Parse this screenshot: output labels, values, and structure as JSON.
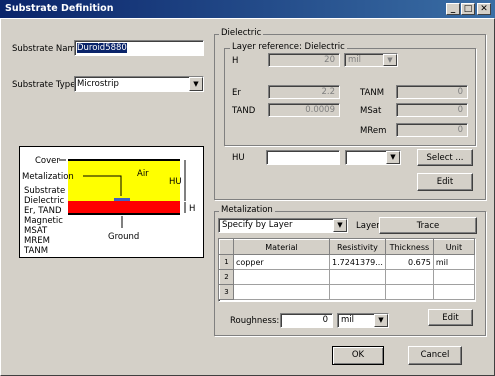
{
  "title": "Substrate Definition",
  "titlebar_buttons": {
    "minimize": "_",
    "maximize": "□",
    "close": "✕"
  },
  "substrate_name": {
    "label": "Substrate Name:",
    "value": "Duroid5880"
  },
  "substrate_type": {
    "label": "Substrate Type:",
    "value": "Microstrip"
  },
  "diagram": {
    "cover": "Cover",
    "metalization": "Metalization",
    "air": "Air",
    "hu": "HU",
    "h": "H",
    "ground": "Ground",
    "substrate_lines": [
      "Substrate",
      "Dielectric",
      "Er, TAND",
      "Magnetic",
      "MSAT",
      "MREM",
      "TANM"
    ]
  },
  "dielectric": {
    "group_label": "Dielectric",
    "layer_label": "Layer reference: Dielectric",
    "h_label": "H",
    "h_value": "20",
    "h_unit": "mil",
    "er_label": "Er",
    "er_value": "2.2",
    "tand_label": "TAND",
    "tand_value": "0.0009",
    "tanm_label": "TANM",
    "tanm_value": "0",
    "msat_label": "MSat",
    "msat_value": "0",
    "mrem_label": "MRem",
    "mrem_value": "0",
    "hu_label": "HU",
    "hu_value": "",
    "hu_unit": "",
    "select_button": "Select ...",
    "edit_button": "Edit"
  },
  "metalization": {
    "group_label": "Metalization",
    "mode": "Specify by Layer",
    "layer_label": "Layer:",
    "layer_button": "Trace",
    "columns": [
      "Material",
      "Resistivity",
      "Thickness",
      "Unit"
    ],
    "rows": [
      {
        "num": "1",
        "material": "copper",
        "resistivity": "1.7241379...",
        "thickness": "0.675",
        "unit": "mil"
      },
      {
        "num": "2",
        "material": "",
        "resistivity": "",
        "thickness": "",
        "unit": ""
      },
      {
        "num": "3",
        "material": "",
        "resistivity": "",
        "thickness": "",
        "unit": ""
      }
    ],
    "roughness_label": "Roughness:",
    "roughness_value": "0",
    "roughness_unit": "mil",
    "edit_button": "Edit"
  },
  "ok_button": "OK",
  "cancel_button": "Cancel",
  "colors": {
    "air": "#ffff00",
    "substrate": "#ff0000",
    "title_start": "#0a246a",
    "title_end": "#3a6ea5"
  }
}
